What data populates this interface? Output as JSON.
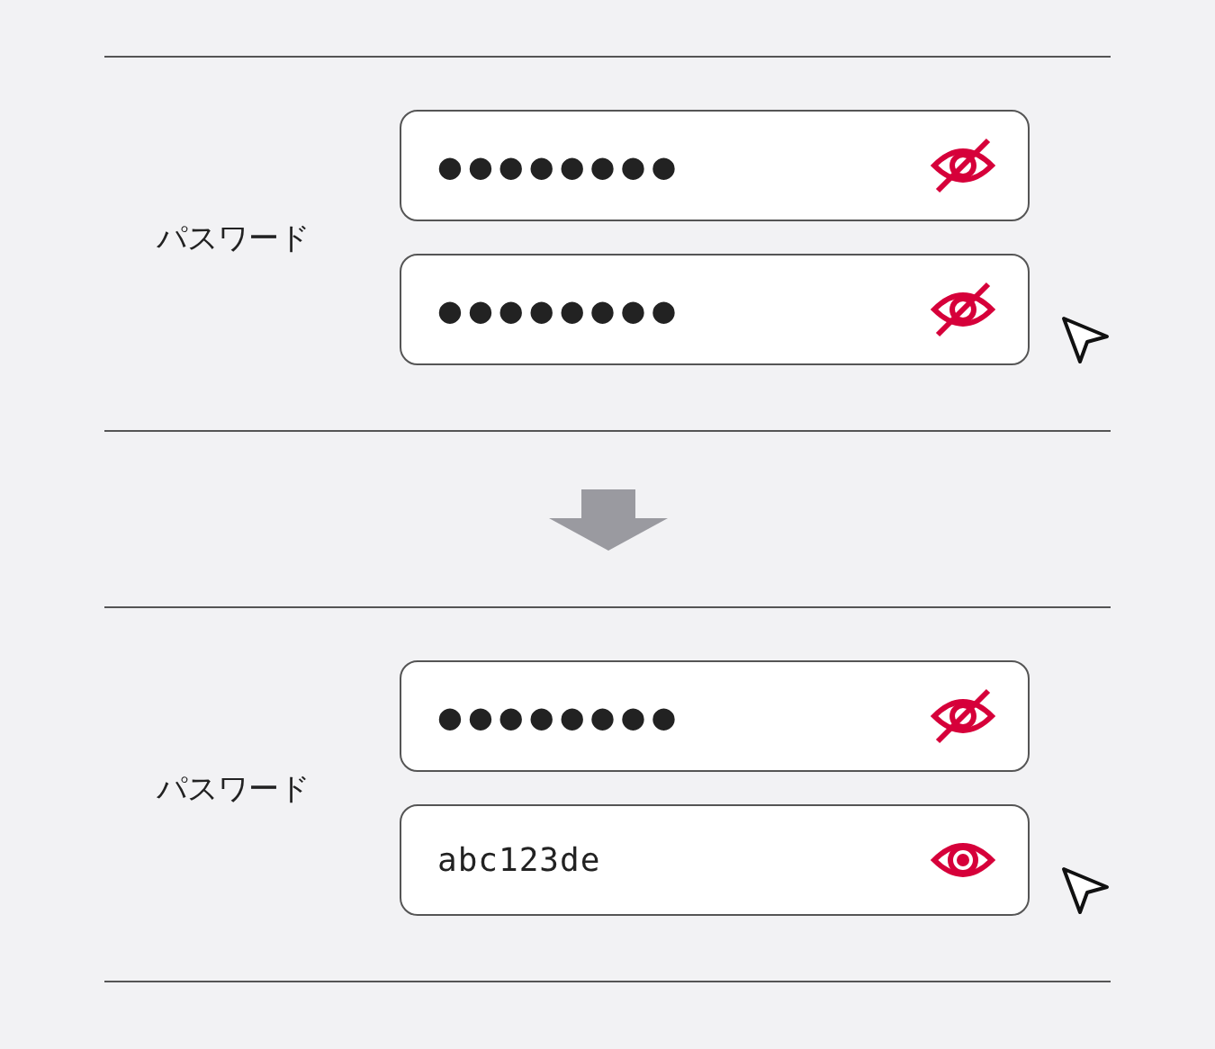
{
  "sections": [
    {
      "label": "パスワード",
      "fields": [
        {
          "value": "●●●●●●●●",
          "revealed": false,
          "pointer": false
        },
        {
          "value": "●●●●●●●●",
          "revealed": false,
          "pointer": true
        }
      ]
    },
    {
      "label": "パスワード",
      "fields": [
        {
          "value": "●●●●●●●●",
          "revealed": false,
          "pointer": false
        },
        {
          "value": "abc123de",
          "revealed": true,
          "pointer": true
        }
      ]
    }
  ]
}
